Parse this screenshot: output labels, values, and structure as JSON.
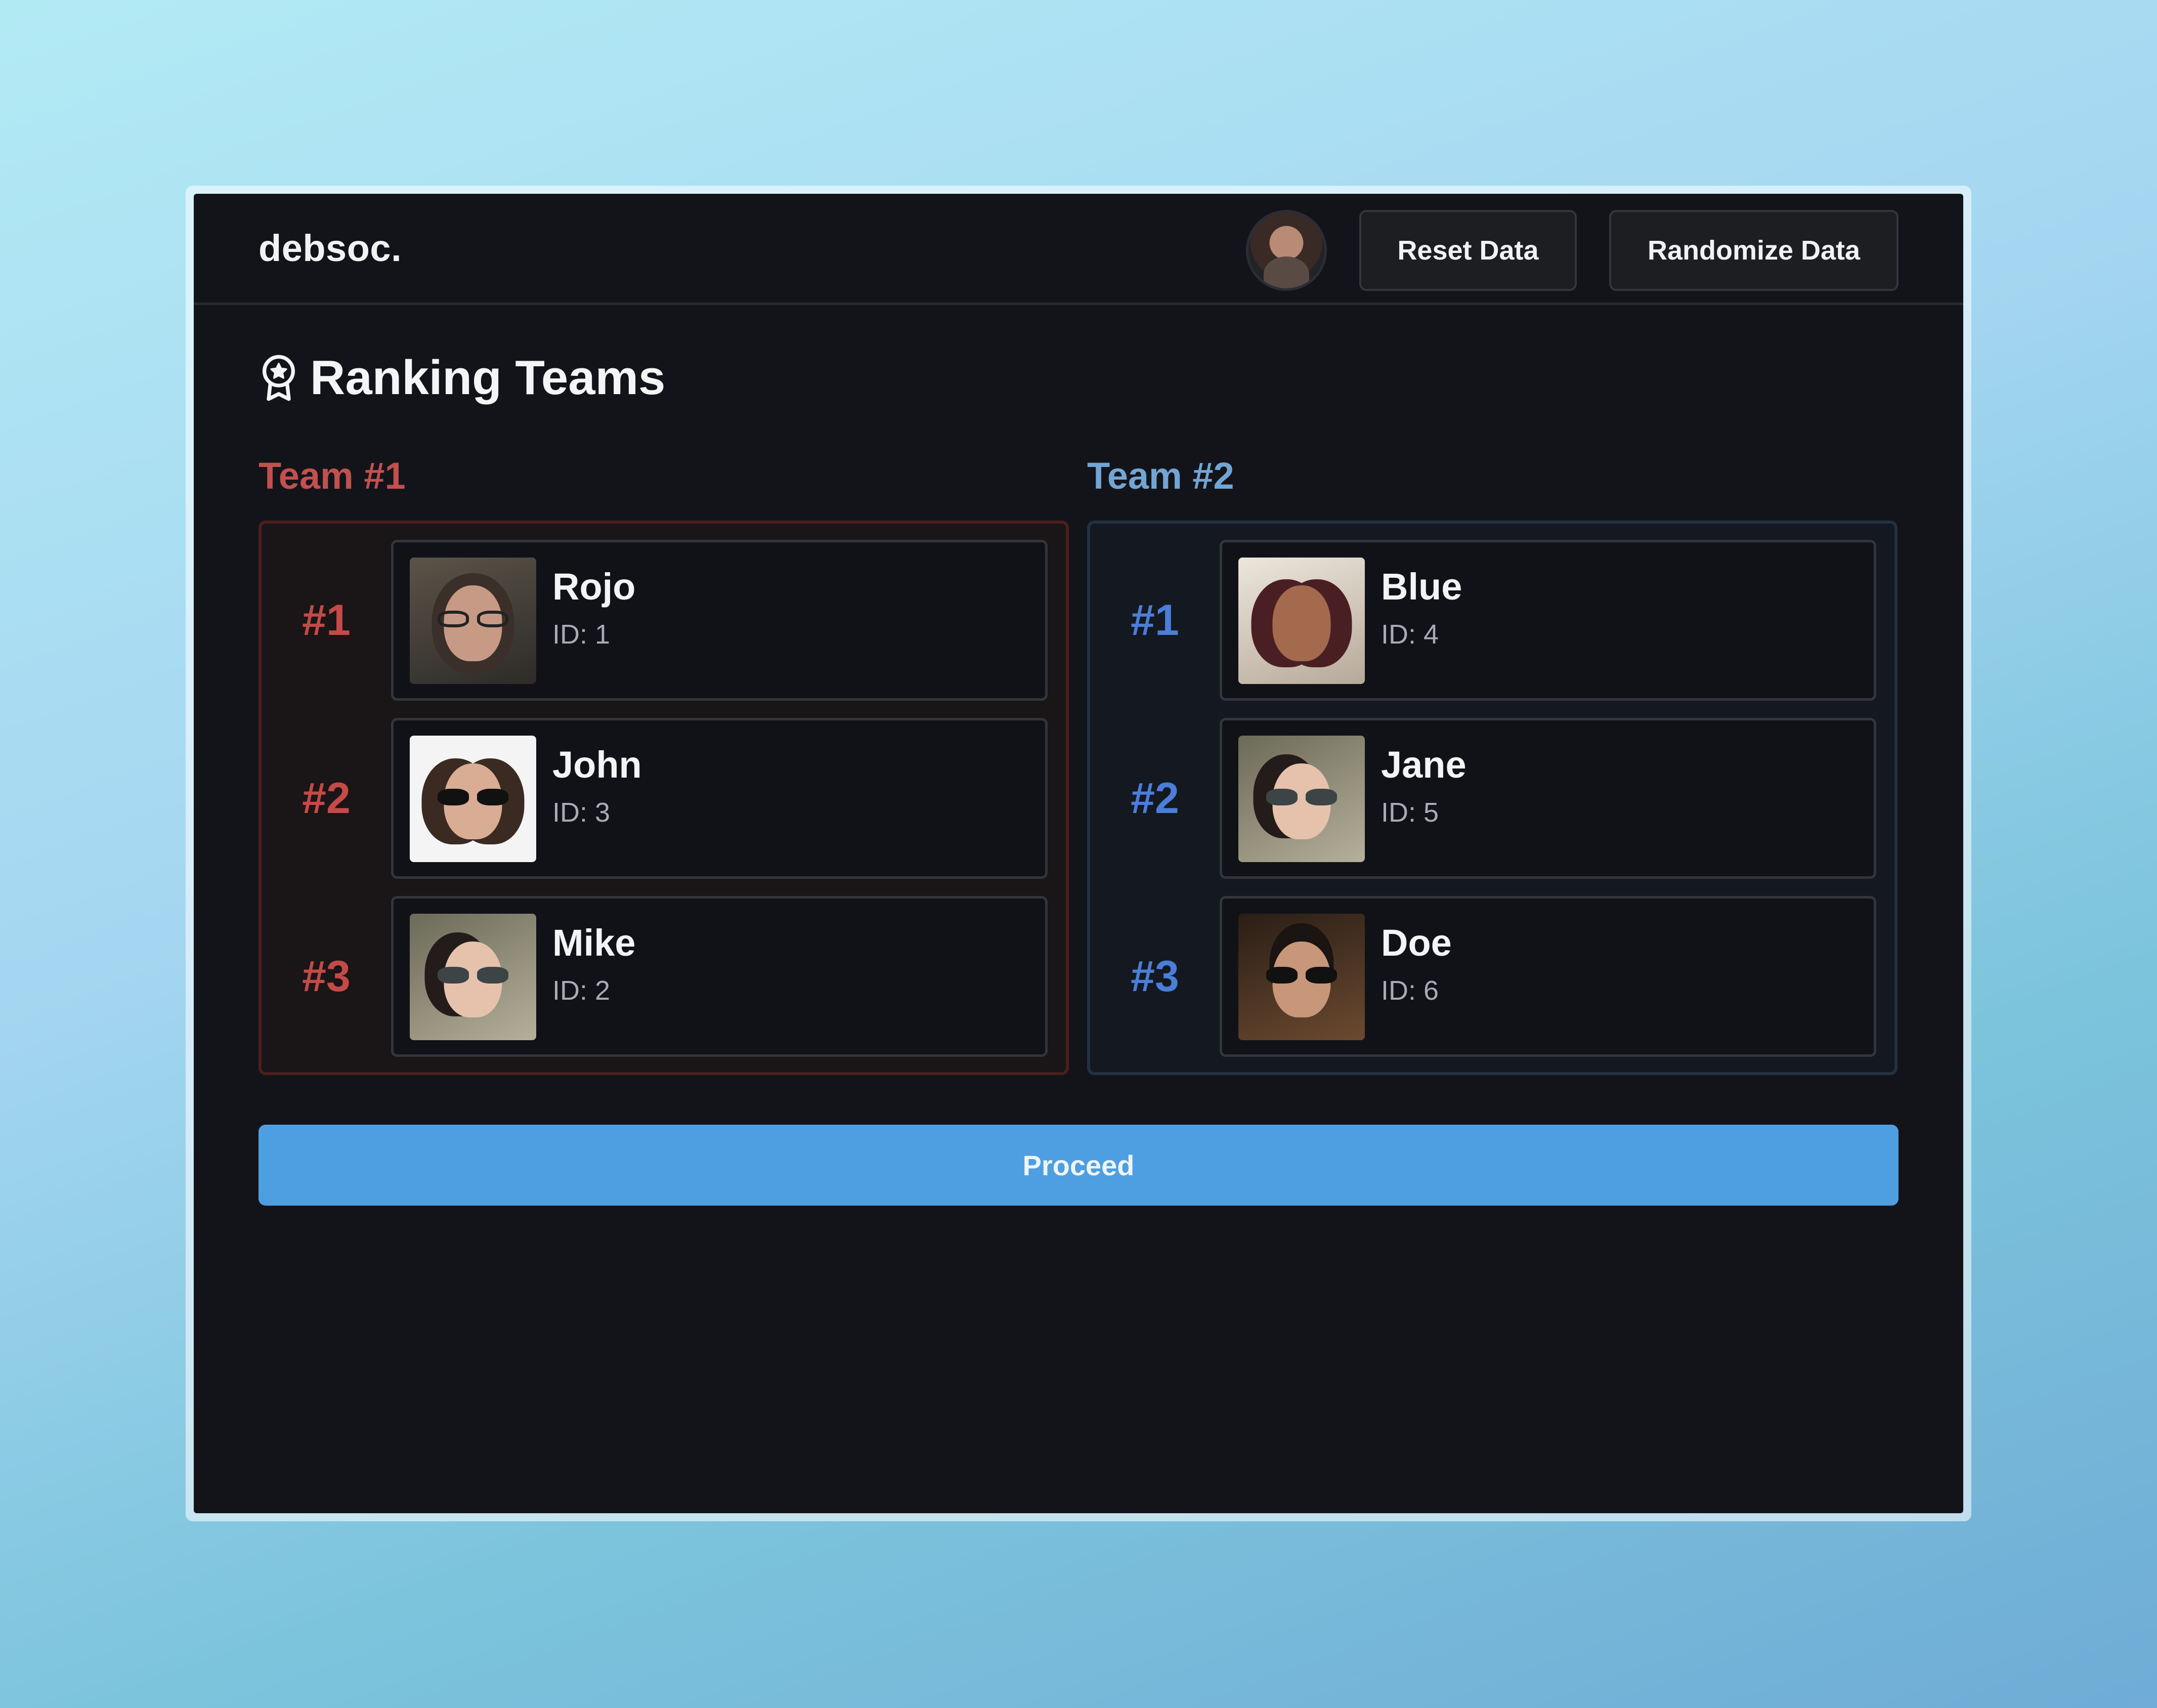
{
  "header": {
    "brand": "debsoc.",
    "reset_label": "Reset Data",
    "randomize_label": "Randomize Data"
  },
  "page": {
    "title": "Ranking Teams",
    "title_icon": "award-badge-icon"
  },
  "teams": [
    {
      "label": "Team #1",
      "color": "#c2504e",
      "members": [
        {
          "rank": "#1",
          "name": "Rojo",
          "id": "ID: 1",
          "photo": "photo-1"
        },
        {
          "rank": "#2",
          "name": "John",
          "id": "ID: 3",
          "photo": "photo-3"
        },
        {
          "rank": "#3",
          "name": "Mike",
          "id": "ID: 2",
          "photo": "photo-2"
        }
      ]
    },
    {
      "label": "Team #2",
      "color": "#72a5d3",
      "members": [
        {
          "rank": "#1",
          "name": "Blue",
          "id": "ID: 4",
          "photo": "photo-4"
        },
        {
          "rank": "#2",
          "name": "Jane",
          "id": "ID: 5",
          "photo": "photo-5"
        },
        {
          "rank": "#3",
          "name": "Doe",
          "id": "ID: 6",
          "photo": "photo-6"
        }
      ]
    }
  ],
  "actions": {
    "proceed_label": "Proceed",
    "proceed_color": "#4e9fe2"
  }
}
